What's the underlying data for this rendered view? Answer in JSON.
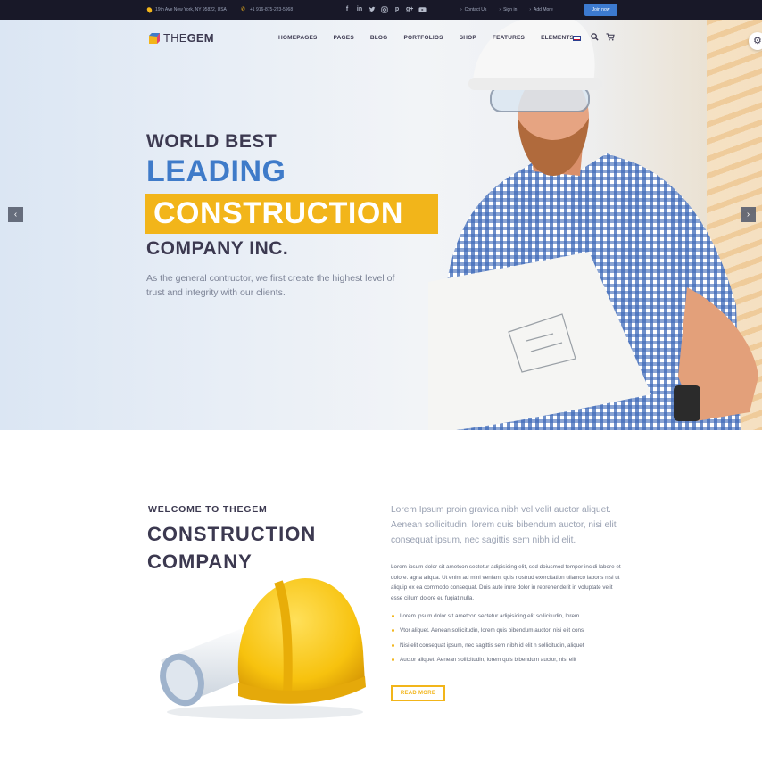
{
  "topbar": {
    "address": "19th Ave New York, NY 95822, USA",
    "phone": "+1 916-875-223-5968",
    "socials": [
      "facebook-icon",
      "linkedin-icon",
      "twitter-icon",
      "instagram-icon",
      "pinterest-icon",
      "googleplus-icon",
      "youtube-icon"
    ],
    "links": [
      "Contact Us",
      "Sign in",
      "Add More"
    ],
    "join_label": "Join now"
  },
  "header": {
    "logo_thin": "THE",
    "logo_bold": "GEM",
    "nav": [
      "HOMEPAGES",
      "PAGES",
      "BLOG",
      "PORTFOLIOS",
      "SHOP",
      "FEATURES",
      "ELEMENTS"
    ]
  },
  "hero": {
    "line1": "WORLD BEST",
    "line2": "LEADING",
    "line3": "CONSTRUCTION",
    "line4": "COMPANY INC.",
    "description": "As the general contructor, we first create the highest level of trust and integrity with our clients.",
    "prev_arrow": "‹",
    "next_arrow": "›"
  },
  "welcome": {
    "kicker": "WELCOME TO THEGEM",
    "title_line1": "CONSTRUCTION",
    "title_line2": "COMPANY",
    "lead": "Lorem Ipsum proin gravida nibh vel velit auctor aliquet. Aenean sollicitudin, lorem quis bibendum auctor, nisi elit consequat ipsum, nec sagittis sem nibh id elit.",
    "body": "Lorem ipsum dolor sit ametcon sectetur adipisicing elit, sed doiusmod tempor incidi labore et dolore. agna aliqua. Ut enim ad mini veniam, quis nostrud exercitation ullamco laboris nisi ut aliquip ex ea commodo consequat. Duis aute irure dolor in reprehenderit in voluptate velit esse cillum dolore eu fugiat nulla.",
    "list": [
      "Lorem ipsum dolor sit ametcon sectetur adipisicing elit sollicitudin, lorem",
      "Vtor aliquet. Aenean sollicitudin, lorem quis bibendum auctor, nisi elit cons",
      "Nisi elit consequat ipsum, nec sagittis sem nibh id elit n sollicitudin, aliquet",
      "Auctor aliquet. Aenean sollicitudin, lorem quis bibendum auctor, nisi elit"
    ],
    "read_more": "READ MORE"
  },
  "colors": {
    "accent_yellow": "#f2b51a",
    "accent_blue": "#3f7bc9",
    "dark_text": "#3c3950",
    "topbar_bg": "#181828"
  }
}
